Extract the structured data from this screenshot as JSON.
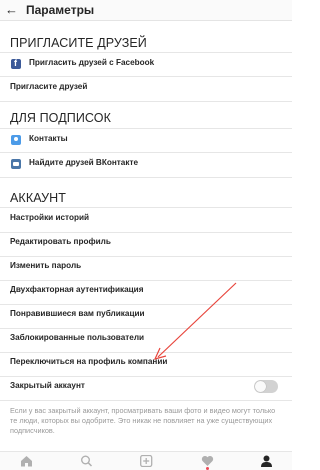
{
  "header": {
    "back_icon": "arrow-left-icon",
    "title": "Параметры"
  },
  "sections": {
    "invite": {
      "title": "ПРИГЛАСИТЕ ДРУЗЕЙ",
      "items": [
        {
          "label": "Пригласить друзей с Facebook",
          "icon": "facebook-icon"
        },
        {
          "label": "Пригласите друзей"
        }
      ]
    },
    "follow": {
      "title": "ДЛЯ ПОДПИСОК",
      "items": [
        {
          "label": "Контакты",
          "icon": "contacts-icon"
        },
        {
          "label": "Найдите друзей ВКонтакте",
          "icon": "vk-icon"
        }
      ]
    },
    "account": {
      "title": "АККАУНТ",
      "items": [
        {
          "label": "Настройки историй"
        },
        {
          "label": "Редактировать профиль"
        },
        {
          "label": "Изменить пароль"
        },
        {
          "label": "Двухфакторная аутентификация"
        },
        {
          "label": "Понравившиеся вам публикации"
        },
        {
          "label": "Заблокированные пользователи"
        },
        {
          "label": "Переключиться на профиль компании"
        }
      ],
      "private": {
        "label": "Закрытый аккаунт",
        "enabled": false
      },
      "footnote": "Если у вас закрытый аккаунт, просматривать ваши фото и видео могут только те люди, которых вы одобрите. Это никак не повлияет на уже существующих подписчиков."
    }
  },
  "annotation": {
    "type": "red-arrow",
    "color": "#e8453c"
  },
  "tabbar": {
    "tabs": [
      "home-icon",
      "search-icon",
      "add-icon",
      "heart-icon",
      "profile-icon"
    ]
  },
  "colors": {
    "background": "#ffffff",
    "text": "#262626",
    "muted": "#999999",
    "facebook": "#3b5998",
    "vk": "#4a76a8",
    "notification": "#ed4956"
  }
}
